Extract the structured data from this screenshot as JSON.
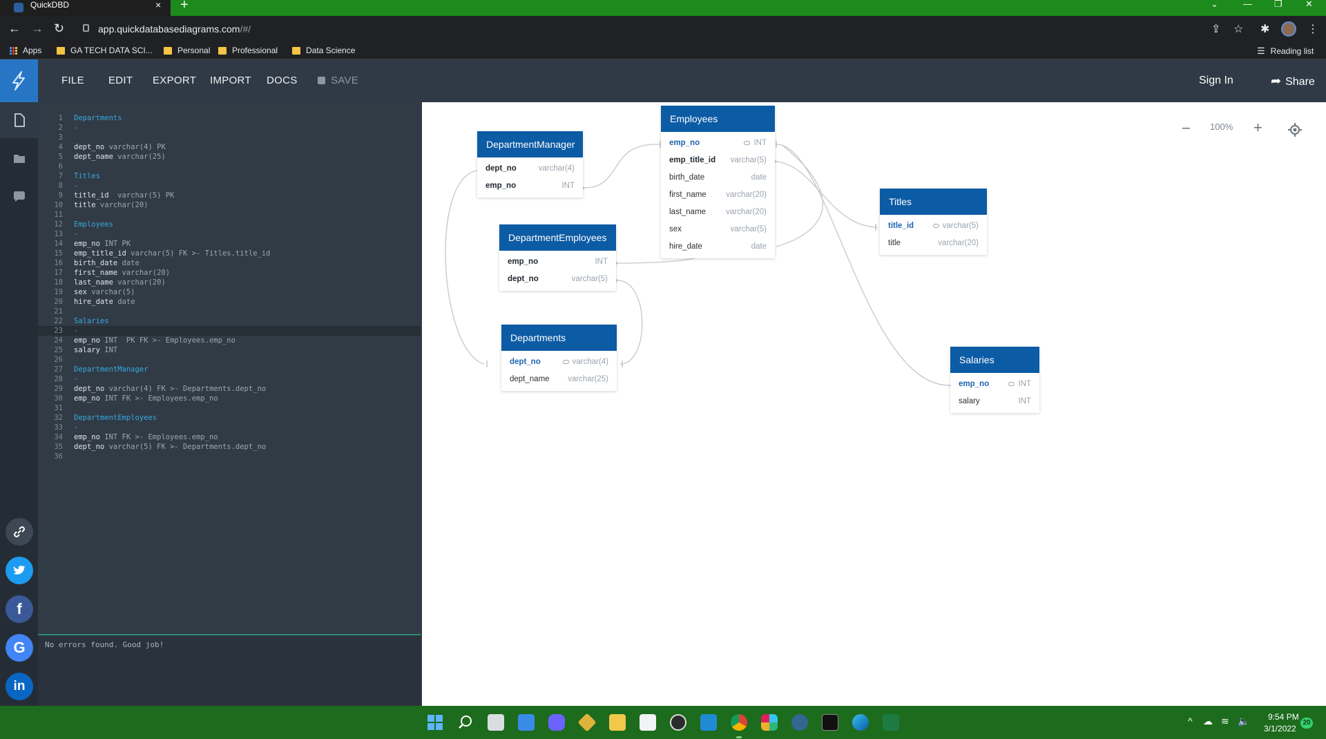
{
  "browser": {
    "tab_title": "QuickDBD",
    "tab_close": "×",
    "new_tab": "+",
    "url_host": "app.quickdatabasediagrams.com",
    "url_path": "/#/",
    "bookmarks": [
      "Apps",
      "GA TECH DATA SCI...",
      "Personal",
      "Professional",
      "Data Science"
    ],
    "reading_list": "Reading list"
  },
  "app": {
    "menu": [
      "FILE",
      "EDIT",
      "EXPORT",
      "IMPORT",
      "DOCS"
    ],
    "save_label": "SAVE",
    "sign_in": "Sign In",
    "share": "Share",
    "zoom": "100%"
  },
  "editor": {
    "lines": [
      {
        "n": "1",
        "kind": "tbl",
        "text": "Departments"
      },
      {
        "n": "2",
        "kind": "dash",
        "text": "-"
      },
      {
        "n": "3",
        "kind": "blank",
        "text": ""
      },
      {
        "n": "4",
        "kind": "code",
        "name": "dept_no",
        "rest": " varchar(4) PK"
      },
      {
        "n": "5",
        "kind": "code",
        "name": "dept_name",
        "rest": " varchar(25)"
      },
      {
        "n": "6",
        "kind": "blank",
        "text": ""
      },
      {
        "n": "7",
        "kind": "tbl",
        "text": "Titles"
      },
      {
        "n": "8",
        "kind": "dash",
        "text": "-"
      },
      {
        "n": "9",
        "kind": "code",
        "name": "title_id",
        "rest": "  varchar(5) PK"
      },
      {
        "n": "10",
        "kind": "code",
        "name": "title",
        "rest": " varchar(20)"
      },
      {
        "n": "11",
        "kind": "blank",
        "text": ""
      },
      {
        "n": "12",
        "kind": "tbl",
        "text": "Employees"
      },
      {
        "n": "13",
        "kind": "dash",
        "text": "-"
      },
      {
        "n": "14",
        "kind": "code",
        "name": "emp_no",
        "rest": " INT PK"
      },
      {
        "n": "15",
        "kind": "code",
        "name": "emp_title_id",
        "rest": " varchar(5) FK >- Titles.title_id"
      },
      {
        "n": "16",
        "kind": "code",
        "name": "birth_date",
        "rest": " date"
      },
      {
        "n": "17",
        "kind": "code",
        "name": "first_name",
        "rest": " varchar(20)"
      },
      {
        "n": "18",
        "kind": "code",
        "name": "last_name",
        "rest": " varchar(20)"
      },
      {
        "n": "19",
        "kind": "code",
        "name": "sex",
        "rest": " varchar(5)"
      },
      {
        "n": "20",
        "kind": "code",
        "name": "hire_date",
        "rest": " date"
      },
      {
        "n": "21",
        "kind": "blank",
        "text": ""
      },
      {
        "n": "22",
        "kind": "tbl",
        "text": "Salaries"
      },
      {
        "n": "23",
        "kind": "dash",
        "text": "-"
      },
      {
        "n": "24",
        "kind": "code",
        "name": "emp_no",
        "rest": " INT  PK FK >- Employees.emp_no"
      },
      {
        "n": "25",
        "kind": "code",
        "name": "salary",
        "rest": " INT"
      },
      {
        "n": "26",
        "kind": "blank",
        "text": ""
      },
      {
        "n": "27",
        "kind": "tbl",
        "text": "DepartmentManager"
      },
      {
        "n": "28",
        "kind": "dash",
        "text": "-"
      },
      {
        "n": "29",
        "kind": "code",
        "name": "dept_no",
        "rest": " varchar(4) FK >- Departments.dept_no"
      },
      {
        "n": "30",
        "kind": "code",
        "name": "emp_no",
        "rest": " INT FK >- Employees.emp_no"
      },
      {
        "n": "31",
        "kind": "blank",
        "text": ""
      },
      {
        "n": "32",
        "kind": "tbl",
        "text": "DepartmentEmployees"
      },
      {
        "n": "33",
        "kind": "dash",
        "text": "-"
      },
      {
        "n": "34",
        "kind": "code",
        "name": "emp_no",
        "rest": " INT FK >- Employees.emp_no"
      },
      {
        "n": "35",
        "kind": "code",
        "name": "dept_no",
        "rest": " varchar(5) FK >- Departments.dept_no"
      },
      {
        "n": "36",
        "kind": "blank",
        "text": ""
      }
    ],
    "active_line": 23,
    "console_message": "No errors found. Good job!"
  },
  "tables": {
    "employees": {
      "title": "Employees",
      "rows": [
        {
          "name": "emp_no",
          "type": "INT",
          "pk": true
        },
        {
          "name": "emp_title_id",
          "type": "varchar(5)",
          "fk": true
        },
        {
          "name": "birth_date",
          "type": "date"
        },
        {
          "name": "first_name",
          "type": "varchar(20)"
        },
        {
          "name": "last_name",
          "type": "varchar(20)"
        },
        {
          "name": "sex",
          "type": "varchar(5)"
        },
        {
          "name": "hire_date",
          "type": "date"
        }
      ]
    },
    "department_manager": {
      "title": "DepartmentManager",
      "rows": [
        {
          "name": "dept_no",
          "type": "varchar(4)",
          "fk": true
        },
        {
          "name": "emp_no",
          "type": "INT",
          "fk": true
        }
      ]
    },
    "department_employees": {
      "title": "DepartmentEmployees",
      "rows": [
        {
          "name": "emp_no",
          "type": "INT",
          "fk": true
        },
        {
          "name": "dept_no",
          "type": "varchar(5)",
          "fk": true
        }
      ]
    },
    "departments": {
      "title": "Departments",
      "rows": [
        {
          "name": "dept_no",
          "type": "varchar(4)",
          "pk": true
        },
        {
          "name": "dept_name",
          "type": "varchar(25)"
        }
      ]
    },
    "titles": {
      "title": "Titles",
      "rows": [
        {
          "name": "title_id",
          "type": "varchar(5)",
          "pk": true
        },
        {
          "name": "title",
          "type": "varchar(20)"
        }
      ]
    },
    "salaries": {
      "title": "Salaries",
      "rows": [
        {
          "name": "emp_no",
          "type": "INT",
          "pk": true
        },
        {
          "name": "salary",
          "type": "INT"
        }
      ]
    }
  },
  "taskbar": {
    "time": "9:54 PM",
    "date": "3/1/2022",
    "badge": "20"
  },
  "colors": {
    "table_header": "#0c5ba5",
    "accent": "#2776c5",
    "taskbar": "#1d6b1d"
  }
}
